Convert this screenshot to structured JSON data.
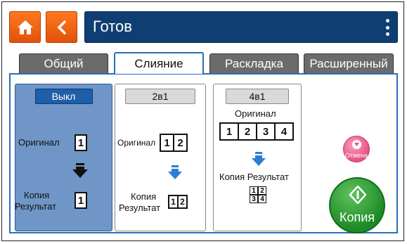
{
  "header": {
    "title": "Готов",
    "icons": {
      "home": "home-icon",
      "back": "back-chevron-icon",
      "menu": "kebab-menu-icon"
    },
    "colors": {
      "orange": "#ff7a1f",
      "navy": "#0f3f72"
    }
  },
  "tabs": [
    {
      "label": "Общий",
      "active": false
    },
    {
      "label": "Слияние",
      "active": true
    },
    {
      "label": "Раскладка",
      "active": false
    },
    {
      "label": "Расширенный",
      "active": false
    }
  ],
  "options": {
    "off": {
      "button": "Выкл",
      "original_label": "Оригинал",
      "original_pages": [
        "1"
      ],
      "result_label_1": "Копия",
      "result_label_2": "Результат",
      "result_pages": [
        "1"
      ],
      "selected": true
    },
    "two_in_one": {
      "button": "2в1",
      "original_label": "Оригинал",
      "original_pages": [
        "1",
        "2"
      ],
      "result_label_1": "Копия",
      "result_label_2": "Результат",
      "result_pages": [
        "1",
        "2"
      ]
    },
    "four_in_one": {
      "button": "4в1",
      "original_label": "Оригинал",
      "original_pages": [
        "1",
        "2",
        "3",
        "4"
      ],
      "result_label": "Копия Результат",
      "result_pages": [
        "1",
        "2",
        "3",
        "4"
      ]
    }
  },
  "actions": {
    "cancel_label": "Отмена",
    "copy_label": "Копия",
    "colors": {
      "cancel": "#e54f85",
      "copy": "#1e8a25"
    }
  }
}
